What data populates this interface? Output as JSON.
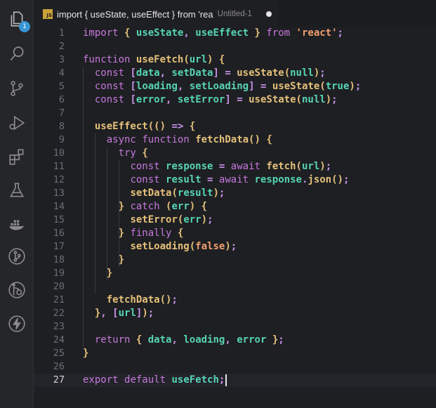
{
  "activity_bar": {
    "explorer_badge": "1",
    "icons": [
      "files-icon",
      "search-icon",
      "source-control-icon",
      "run-debug-icon",
      "extensions-icon",
      "testing-icon",
      "docker-icon",
      "git-graph-icon",
      "gitlens-icon",
      "lightning-icon"
    ]
  },
  "tab": {
    "title": "import { useState, useEffect } from 'rea",
    "description": "Untitled-1",
    "language_badge": "JS",
    "unsaved": true
  },
  "editor": {
    "active_line": 27,
    "lines": [
      "import { useState, useEffect } from 'react';",
      "",
      "function useFetch(url) {",
      "  const [data, setData] = useState(null);",
      "  const [loading, setLoading] = useState(true);",
      "  const [error, setError] = useState(null);",
      "",
      "  useEffect(() => {",
      "    async function fetchData() {",
      "      try {",
      "        const response = await fetch(url);",
      "        const result = await response.json();",
      "        setData(result);",
      "      } catch (err) {",
      "        setError(err);",
      "      } finally {",
      "        setLoading(false);",
      "      }",
      "    }",
      "",
      "    fetchData();",
      "  }, [url]);",
      "",
      "  return { data, loading, error };",
      "}",
      "",
      "export default useFetch;"
    ]
  }
}
